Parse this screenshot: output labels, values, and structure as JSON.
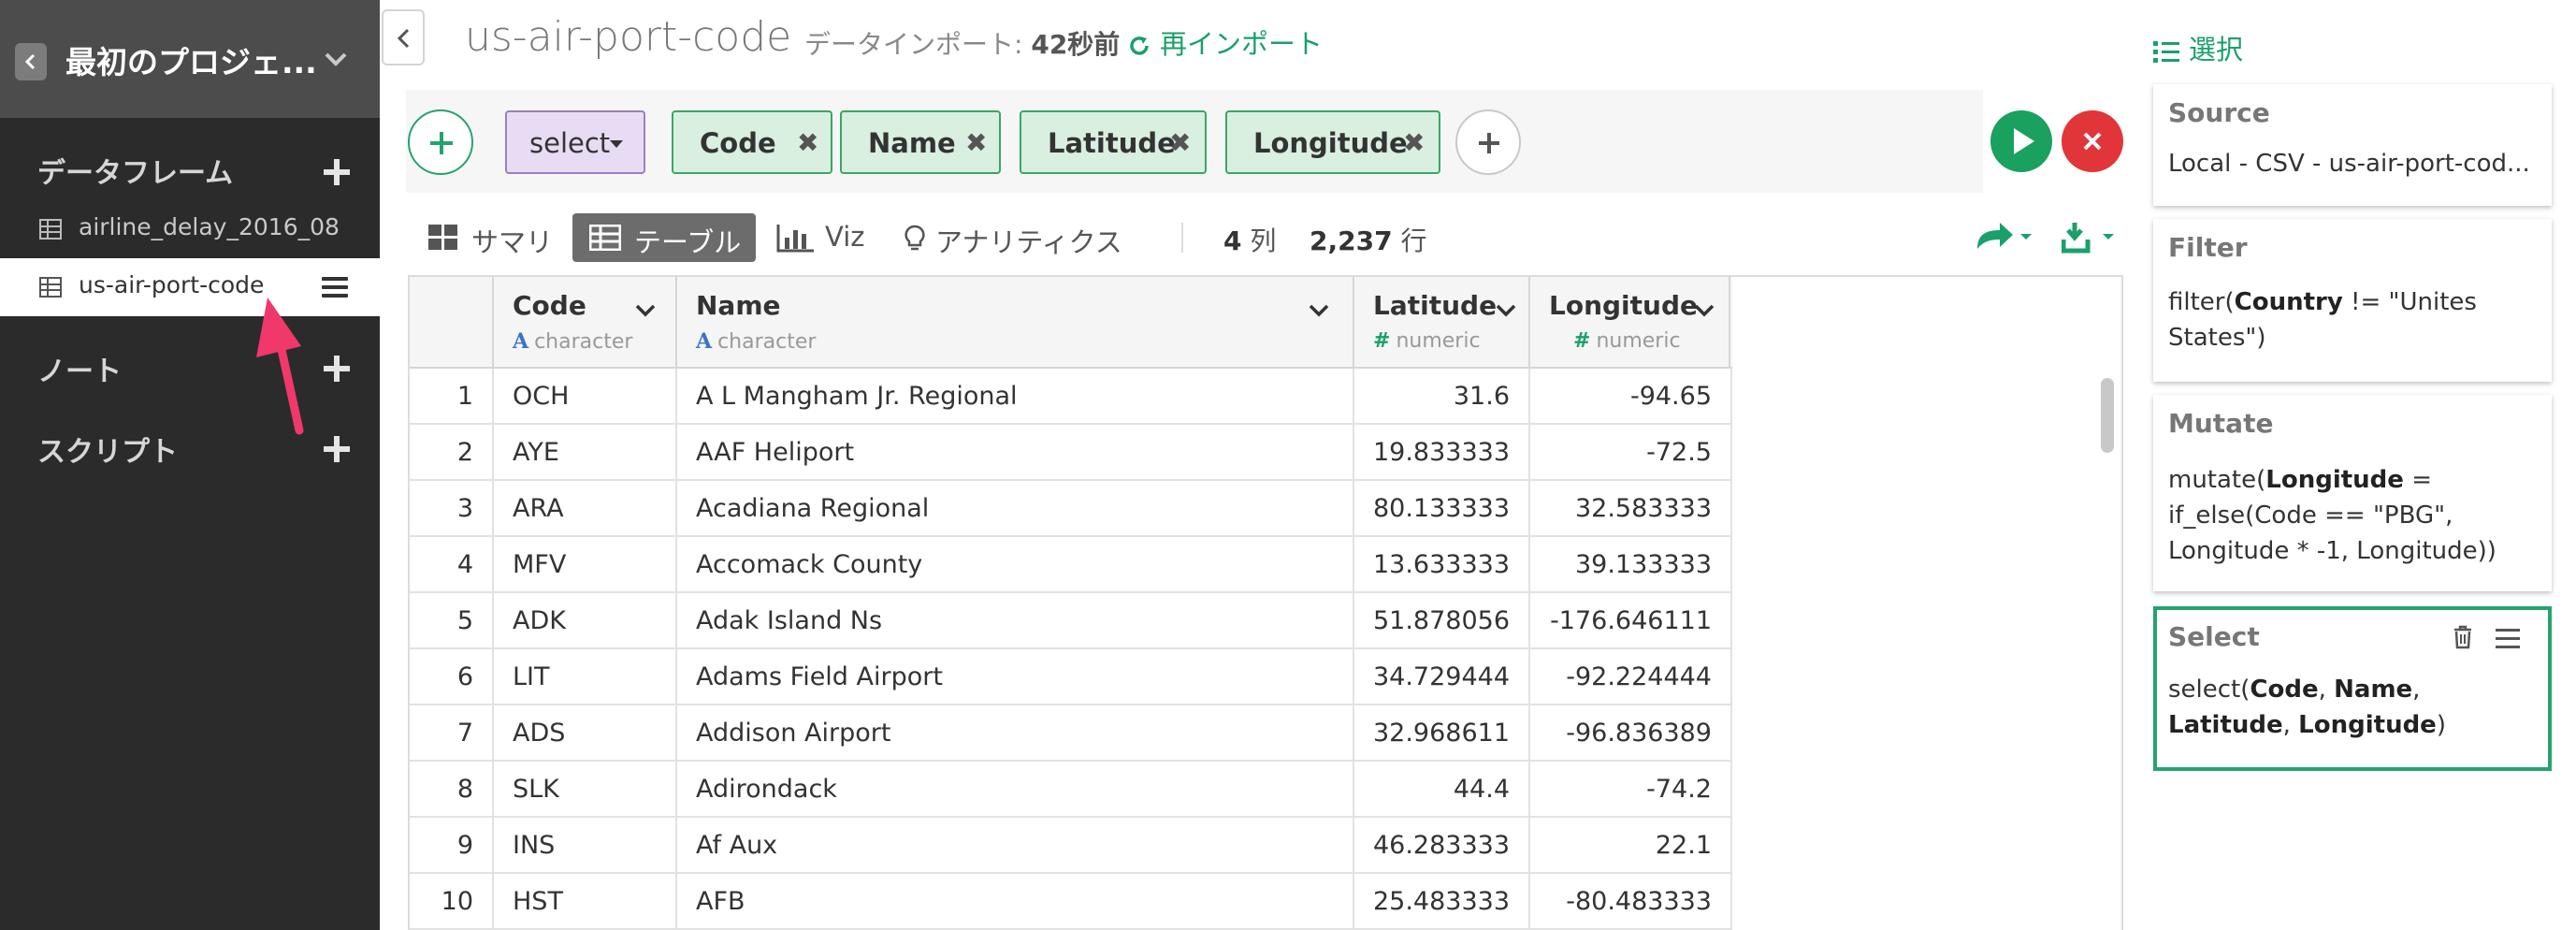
{
  "sidebar": {
    "project_title": "最初のプロジェ...",
    "sections": {
      "dataframes": "データフレーム",
      "notes": "ノート",
      "scripts": "スクリプト"
    },
    "dataframes": [
      {
        "label": "airline_delay_2016_08"
      },
      {
        "label": "us-air-port-code"
      }
    ]
  },
  "header": {
    "title": "us-air-port-code",
    "import_prefix": "データインポート: ",
    "import_time": "42秒前",
    "reimport": "再インポート"
  },
  "command": {
    "function": "select",
    "columns": [
      "Code",
      "Name",
      "Latitude",
      "Longitude"
    ]
  },
  "view_tabs": [
    "サマリ",
    "テーブル",
    "Viz",
    "アナリティクス"
  ],
  "counts": {
    "cols": "4",
    "cols_unit": "列",
    "rows": "2,237",
    "rows_unit": "行"
  },
  "table": {
    "columns": [
      {
        "name": "Code",
        "type": "character"
      },
      {
        "name": "Name",
        "type": "character"
      },
      {
        "name": "Latitude",
        "type": "numeric"
      },
      {
        "name": "Longitude",
        "type": "numeric"
      }
    ],
    "rows": [
      [
        "1",
        "OCH",
        "A L Mangham Jr. Regional",
        "31.6",
        "-94.65"
      ],
      [
        "2",
        "AYE",
        "AAF Heliport",
        "19.833333",
        "-72.5"
      ],
      [
        "3",
        "ARA",
        "Acadiana Regional",
        "80.133333",
        "32.583333"
      ],
      [
        "4",
        "MFV",
        "Accomack County",
        "13.633333",
        "39.133333"
      ],
      [
        "5",
        "ADK",
        "Adak Island Ns",
        "51.878056",
        "-176.646111"
      ],
      [
        "6",
        "LIT",
        "Adams Field Airport",
        "34.729444",
        "-92.224444"
      ],
      [
        "7",
        "ADS",
        "Addison Airport",
        "32.968611",
        "-96.836389"
      ],
      [
        "8",
        "SLK",
        "Adirondack",
        "44.4",
        "-74.2"
      ],
      [
        "9",
        "INS",
        "Af Aux",
        "46.283333",
        "22.1"
      ],
      [
        "10",
        "HST",
        "AFB",
        "25.483333",
        "-80.483333"
      ]
    ]
  },
  "steps_panel": {
    "header": "選択",
    "steps": [
      {
        "title": "Source",
        "body": "Local - CSV - us-air-port-cod..."
      },
      {
        "title": "Filter",
        "parts": [
          "filter(",
          "Country",
          " != \"Unites States\")"
        ]
      },
      {
        "title": "Mutate",
        "parts": [
          "mutate(",
          "Longitude",
          " = if_else(Code == \"PBG\", Longitude * -1, Longitude))"
        ]
      },
      {
        "title": "Select",
        "parts": [
          "select(",
          "Code",
          ", ",
          "Name",
          ", ",
          "Latitude",
          ", ",
          "Longitude",
          ")"
        ]
      }
    ]
  },
  "colors": {
    "accent_green": "#1aa06b",
    "select_purple": "#e7dcf4",
    "chip_green": "#d9efdf",
    "cancel_red": "#e2353a",
    "annotation_pink": "#f0386b"
  }
}
